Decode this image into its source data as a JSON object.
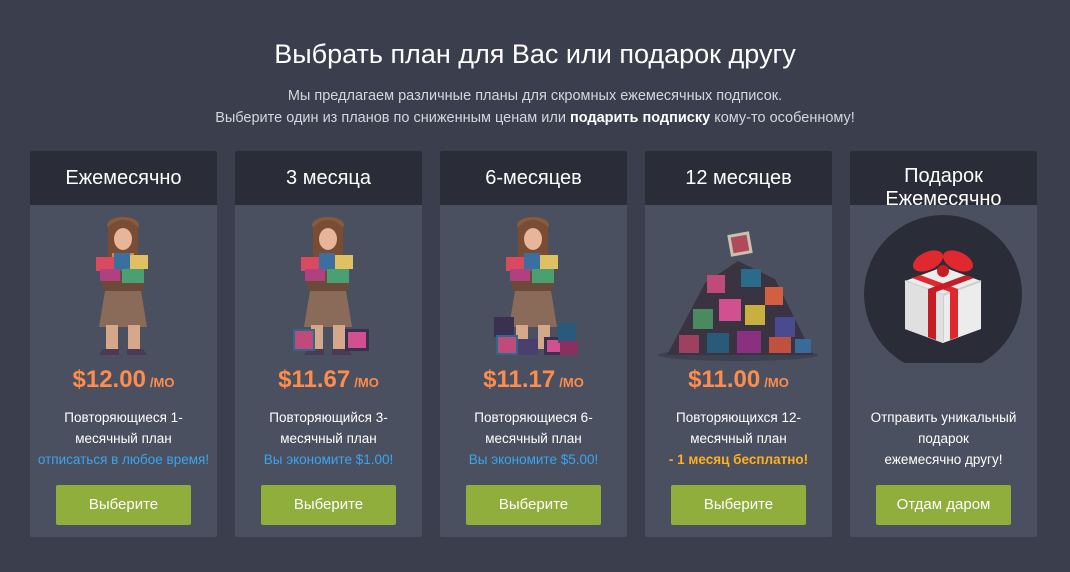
{
  "header": {
    "title": "Выбрать план для Вас или подарок другу",
    "subtitle_line1": "Мы предлагаем различные планы для скромных ежемесячных подписок.",
    "subtitle_line2_a": "Выберите один из планов по сниженным ценам или ",
    "subtitle_line2_bold": "подарить подписку",
    "subtitle_line2_b": " кому-то особенному!"
  },
  "colors": {
    "background": "#3b3e4c",
    "card": "#4b5060",
    "card_header": "#2a2d37",
    "price": "#ff8c4a",
    "note_blue": "#3aa5ee",
    "note_orange": "#ffb020",
    "button": "#8fae3c"
  },
  "plans": [
    {
      "title": "Ежемесячно",
      "price": "$12.00",
      "period": "/MO",
      "desc_line1": "Повторяющиеся 1-",
      "desc_line2": "месячный план",
      "note": "отписаться в любое время!",
      "button": "Выберите",
      "icon": "character-holding-games-icon"
    },
    {
      "title": "3 месяца",
      "price": "$11.67",
      "period": "/MO",
      "desc_line1": "Повторяющийся 3-",
      "desc_line2": "месячный план",
      "note": "Вы экономите $1.00!",
      "button": "Выберите",
      "icon": "character-with-game-stack-icon"
    },
    {
      "title": "6-месяцев",
      "price": "$11.17",
      "period": "/MO",
      "desc_line1": "Повторяющиеся 6-",
      "desc_line2": "месячный план",
      "note": "Вы экономите $5.00!",
      "button": "Выберите",
      "icon": "character-with-larger-game-stack-icon"
    },
    {
      "title": "12 месяцев",
      "price": "$11.00",
      "period": "/MO",
      "desc_line1": "Повторяющихся 12-",
      "desc_line2": "месячный план",
      "note": "- 1 месяц бесплатно!",
      "button": "Выберите",
      "icon": "game-pile-icon"
    },
    {
      "title": "Подарок Ежемесячно",
      "title_line1": "Подарок",
      "title_line2": "Ежемесячно",
      "desc_line1": "Отправить уникальный",
      "desc_line2": "подарок",
      "desc_line3": "ежемесячно другу!",
      "button": "Отдам даром",
      "icon": "gift-box-icon"
    }
  ]
}
